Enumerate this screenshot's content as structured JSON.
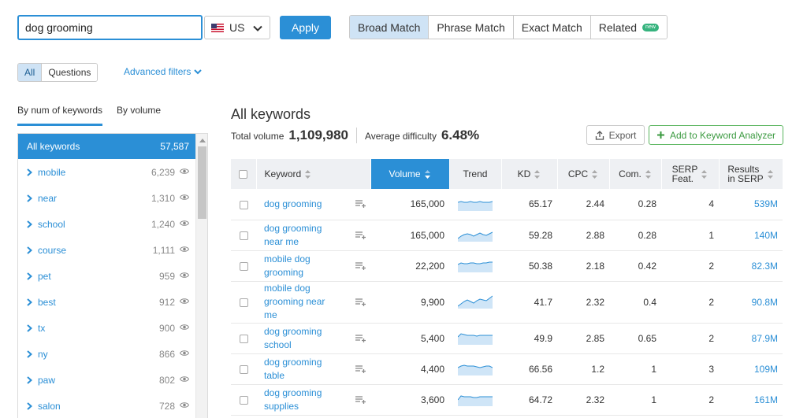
{
  "search": {
    "query": "dog grooming"
  },
  "country": {
    "code": "US"
  },
  "apply_label": "Apply",
  "match_tabs": [
    {
      "label": "Broad Match"
    },
    {
      "label": "Phrase Match"
    },
    {
      "label": "Exact Match"
    },
    {
      "label": "Related",
      "badge": "new"
    }
  ],
  "type_tabs": [
    {
      "label": "All"
    },
    {
      "label": "Questions"
    }
  ],
  "advanced_filters_label": "Advanced filters",
  "sidebar": {
    "tabs": [
      {
        "label": "By num of keywords"
      },
      {
        "label": "By volume"
      }
    ],
    "groups": [
      {
        "label": "All keywords",
        "count": "57,587"
      },
      {
        "label": "mobile",
        "count": "6,239"
      },
      {
        "label": "near",
        "count": "1,310"
      },
      {
        "label": "school",
        "count": "1,240"
      },
      {
        "label": "course",
        "count": "1,111"
      },
      {
        "label": "pet",
        "count": "959"
      },
      {
        "label": "best",
        "count": "912"
      },
      {
        "label": "tx",
        "count": "900"
      },
      {
        "label": "ny",
        "count": "866"
      },
      {
        "label": "paw",
        "count": "802"
      },
      {
        "label": "salon",
        "count": "728"
      }
    ]
  },
  "main": {
    "title": "All keywords",
    "total_volume_label": "Total volume",
    "total_volume": "1,109,980",
    "avg_difficulty_label": "Average difficulty",
    "avg_difficulty": "6.48%",
    "export_label": "Export",
    "add_analyzer_label": "Add to Keyword Analyzer"
  },
  "table": {
    "headers": {
      "keyword": "Keyword",
      "volume": "Volume",
      "trend": "Trend",
      "kd": "KD",
      "cpc": "CPC",
      "com": "Com.",
      "serp_line1": "SERP",
      "serp_line2": "Feat.",
      "results_line1": "Results",
      "results_line2": "in SERP"
    },
    "rows": [
      {
        "keyword": "dog grooming",
        "volume": "165,000",
        "kd": "65.17",
        "cpc": "2.44",
        "com": "0.28",
        "serp": "4",
        "results": "539M",
        "trend": [
          0.55,
          0.6,
          0.55,
          0.55,
          0.6,
          0.55,
          0.55,
          0.6,
          0.55,
          0.55,
          0.55,
          0.6
        ]
      },
      {
        "keyword": "dog grooming near me",
        "volume": "165,000",
        "kd": "59.28",
        "cpc": "2.88",
        "com": "0.28",
        "serp": "1",
        "results": "140M",
        "trend": [
          0.2,
          0.35,
          0.45,
          0.5,
          0.45,
          0.35,
          0.45,
          0.55,
          0.45,
          0.4,
          0.5,
          0.6
        ]
      },
      {
        "keyword": "mobile dog grooming",
        "volume": "22,200",
        "kd": "50.38",
        "cpc": "2.18",
        "com": "0.42",
        "serp": "2",
        "results": "82.3M",
        "trend": [
          0.5,
          0.6,
          0.55,
          0.55,
          0.6,
          0.6,
          0.55,
          0.55,
          0.6,
          0.6,
          0.65,
          0.65
        ]
      },
      {
        "keyword": "mobile dog grooming near me",
        "volume": "9,900",
        "kd": "41.7",
        "cpc": "2.32",
        "com": "0.4",
        "serp": "2",
        "results": "90.8M",
        "trend": [
          0.15,
          0.3,
          0.45,
          0.55,
          0.45,
          0.35,
          0.5,
          0.6,
          0.55,
          0.5,
          0.65,
          0.8
        ]
      },
      {
        "keyword": "dog grooming school",
        "volume": "5,400",
        "kd": "49.9",
        "cpc": "2.85",
        "com": "0.65",
        "serp": "2",
        "results": "87.9M",
        "trend": [
          0.5,
          0.7,
          0.65,
          0.6,
          0.6,
          0.6,
          0.55,
          0.6,
          0.6,
          0.6,
          0.6,
          0.6
        ]
      },
      {
        "keyword": "dog grooming table",
        "volume": "4,400",
        "kd": "66.56",
        "cpc": "1.2",
        "com": "1",
        "serp": "3",
        "results": "109M",
        "trend": [
          0.5,
          0.6,
          0.65,
          0.6,
          0.6,
          0.6,
          0.55,
          0.5,
          0.55,
          0.6,
          0.6,
          0.5
        ]
      },
      {
        "keyword": "dog grooming supplies",
        "volume": "3,600",
        "kd": "64.72",
        "cpc": "2.32",
        "com": "1",
        "serp": "2",
        "results": "161M",
        "trend": [
          0.4,
          0.65,
          0.6,
          0.6,
          0.6,
          0.55,
          0.55,
          0.6,
          0.6,
          0.6,
          0.6,
          0.6
        ]
      }
    ]
  },
  "colors": {
    "accent": "#2b8fd6",
    "active_tab_bg": "#cfe3f5",
    "new_badge": "#36b37e",
    "analyzer": "#3b9a40",
    "header_bg": "#eef0f3",
    "trend_fill": "#cfe5f7"
  }
}
